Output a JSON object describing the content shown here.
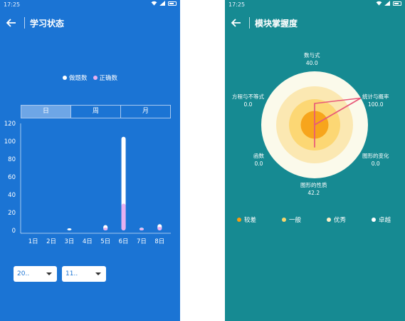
{
  "left_screen": {
    "status_time": "17:25",
    "title": "学习状态",
    "legend": [
      {
        "label": "做题数",
        "color": "#ffffff"
      },
      {
        "label": "正确数",
        "color": "#e7b0f0"
      }
    ],
    "tabs": [
      {
        "label": "日",
        "active": true
      },
      {
        "label": "周",
        "active": false
      },
      {
        "label": "月",
        "active": false
      }
    ],
    "dropdowns": [
      {
        "value": "20.."
      },
      {
        "value": "11.."
      }
    ],
    "chart_data": {
      "type": "bar",
      "categories": [
        "1日",
        "2日",
        "3日",
        "4日",
        "5日",
        "6日",
        "7日",
        "8日"
      ],
      "series": [
        {
          "name": "做题数",
          "values": [
            0,
            0,
            1,
            0,
            6,
            105,
            3,
            7
          ],
          "color": "#ffffff"
        },
        {
          "name": "正确数",
          "values": [
            0,
            0,
            0,
            0,
            3,
            30,
            2,
            4
          ],
          "color": "#e7b0f0"
        }
      ],
      "yticks": [
        "0",
        "20",
        "40",
        "60",
        "80",
        "100",
        "120"
      ],
      "ylim": [
        0,
        120
      ],
      "xlabel": "",
      "ylabel": ""
    }
  },
  "right_screen": {
    "status_time": "17:25",
    "title": "模块掌握度",
    "chart_data": {
      "type": "radar",
      "axes": [
        {
          "name": "数与式",
          "value": 40.0,
          "value_label": "40.0"
        },
        {
          "name": "统计与概率",
          "value": 100.0,
          "value_label": "100.0"
        },
        {
          "name": "图形的变化",
          "value": 0.0,
          "value_label": "0.0"
        },
        {
          "name": "图形的性质",
          "value": 42.2,
          "value_label": "42.2"
        },
        {
          "name": "函数",
          "value": 0.0,
          "value_label": "0.0"
        },
        {
          "name": "方程与不等式",
          "value": 0.0,
          "value_label": "0.0"
        }
      ],
      "max": 100,
      "bands": [
        "#fbfaeb",
        "#fbe8b2",
        "#fcd774",
        "#f7a51c"
      ],
      "line_color": "#e8597a"
    },
    "legend": [
      {
        "label": "较差",
        "color": "#f59d14"
      },
      {
        "label": "一般",
        "color": "#f6d76e"
      },
      {
        "label": "优秀",
        "color": "#fbefc5"
      },
      {
        "label": "卓越",
        "color": "#ffffff"
      }
    ]
  }
}
